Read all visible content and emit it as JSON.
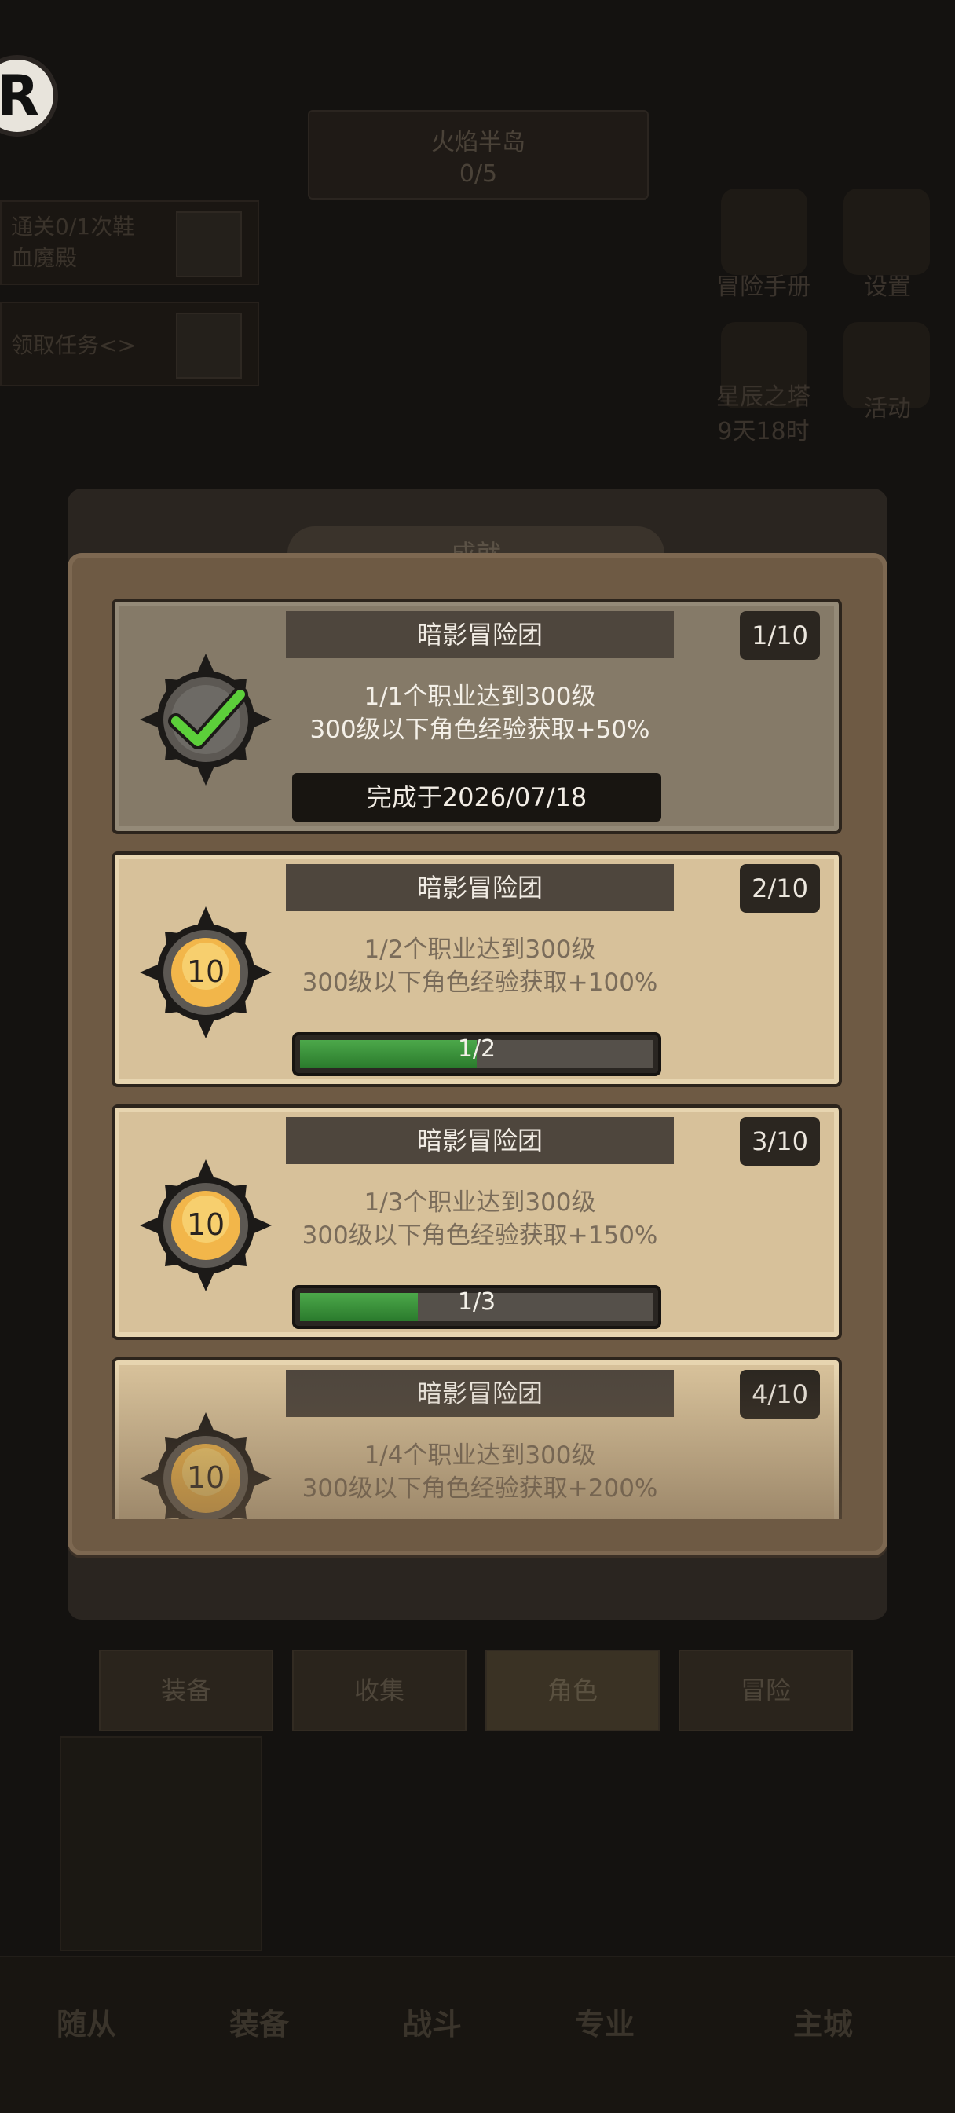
{
  "background": {
    "avatar_letter": "R",
    "area": {
      "name": "火焰半岛",
      "progress": "0/5"
    },
    "quests": [
      "通关0/1次鞋\n血魔殿",
      "领取任务<>"
    ],
    "side_buttons": [
      "冒险手册",
      "设置",
      "星辰之塔\n9天18时",
      "活动"
    ],
    "tabs": [
      "装备",
      "收集",
      "角色",
      "冒险"
    ],
    "bottom_nav": [
      "随从",
      "装备",
      "战斗",
      "专业",
      "主城"
    ],
    "panel_title": "成就"
  },
  "achievements": [
    {
      "title": "暗影冒险团",
      "step": "1/10",
      "line1": "1/1个职业达到300级",
      "line2": "300级以下角色经验获取+50%",
      "status": "completed",
      "completed_text": "完成于2026/07/18"
    },
    {
      "title": "暗影冒险团",
      "step": "2/10",
      "line1": "1/2个职业达到300级",
      "line2": "300级以下角色经验获取+100%",
      "status": "in_progress",
      "reward": "10",
      "progress_text": "1/2",
      "progress_fraction": 0.5
    },
    {
      "title": "暗影冒险团",
      "step": "3/10",
      "line1": "1/3个职业达到300级",
      "line2": "300级以下角色经验获取+150%",
      "status": "in_progress",
      "reward": "10",
      "progress_text": "1/3",
      "progress_fraction": 0.333
    },
    {
      "title": "暗影冒险团",
      "step": "4/10",
      "line1": "1/4个职业达到300级",
      "line2": "300级以下角色经验获取+200%",
      "status": "locked",
      "reward": "10"
    }
  ],
  "colors": {
    "card_active": "#d7c19a",
    "card_done": "#857a68",
    "progress_green": "#3a9a3a",
    "check_green": "#5ccf3a",
    "medal_gold": "#f2b64a"
  }
}
